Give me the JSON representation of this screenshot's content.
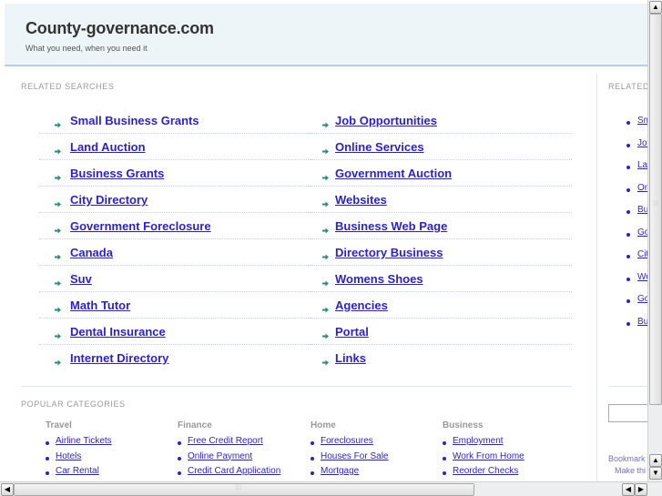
{
  "header": {
    "title": "County-governance.com",
    "tagline": "What you need, when you need it"
  },
  "related_searches": {
    "label": "RELATED SEARCHES",
    "column1": [
      {
        "label": "Small Business Grants"
      },
      {
        "label": "Land Auction"
      },
      {
        "label": "Business Grants"
      },
      {
        "label": "City Directory"
      },
      {
        "label": "Government Foreclosure"
      },
      {
        "label": "Canada"
      },
      {
        "label": "Suv"
      },
      {
        "label": "Math Tutor"
      },
      {
        "label": "Dental Insurance"
      },
      {
        "label": "Internet Directory"
      }
    ],
    "column2": [
      {
        "label": "Job Opportunities"
      },
      {
        "label": "Online Services"
      },
      {
        "label": "Government Auction"
      },
      {
        "label": "Websites"
      },
      {
        "label": "Business Web Page"
      },
      {
        "label": "Directory Business"
      },
      {
        "label": "Womens Shoes"
      },
      {
        "label": "Agencies"
      },
      {
        "label": "Portal"
      },
      {
        "label": "Links"
      }
    ]
  },
  "popular_categories": {
    "label": "POPULAR CATEGORIES",
    "columns": [
      {
        "heading": "Travel",
        "items": [
          "Airline Tickets",
          "Hotels",
          "Car Rental"
        ]
      },
      {
        "heading": "Finance",
        "items": [
          "Free Credit Report",
          "Online Payment",
          "Credit Card Application"
        ]
      },
      {
        "heading": "Home",
        "items": [
          "Foreclosures",
          "Houses For Sale",
          "Mortgage"
        ]
      },
      {
        "heading": "Business",
        "items": [
          "Employment",
          "Work From Home",
          "Reorder Checks"
        ]
      }
    ]
  },
  "sidebar": {
    "label": "RELATED",
    "items": [
      "Sm",
      "Jol",
      "Lar",
      "On",
      "Bu",
      "Go",
      "Cit",
      "We",
      "Go",
      "Bu"
    ],
    "bookmark": "Bookmark",
    "make_this": "Make thi"
  },
  "scrollbars": {
    "up_icon": "▲",
    "down_icon": "▼",
    "left_icon": "◀",
    "right_icon": "▶"
  },
  "colors": {
    "link": "#2b1fd6",
    "arrow": "#2e8b7a",
    "header_bg": "#eef5f8"
  }
}
